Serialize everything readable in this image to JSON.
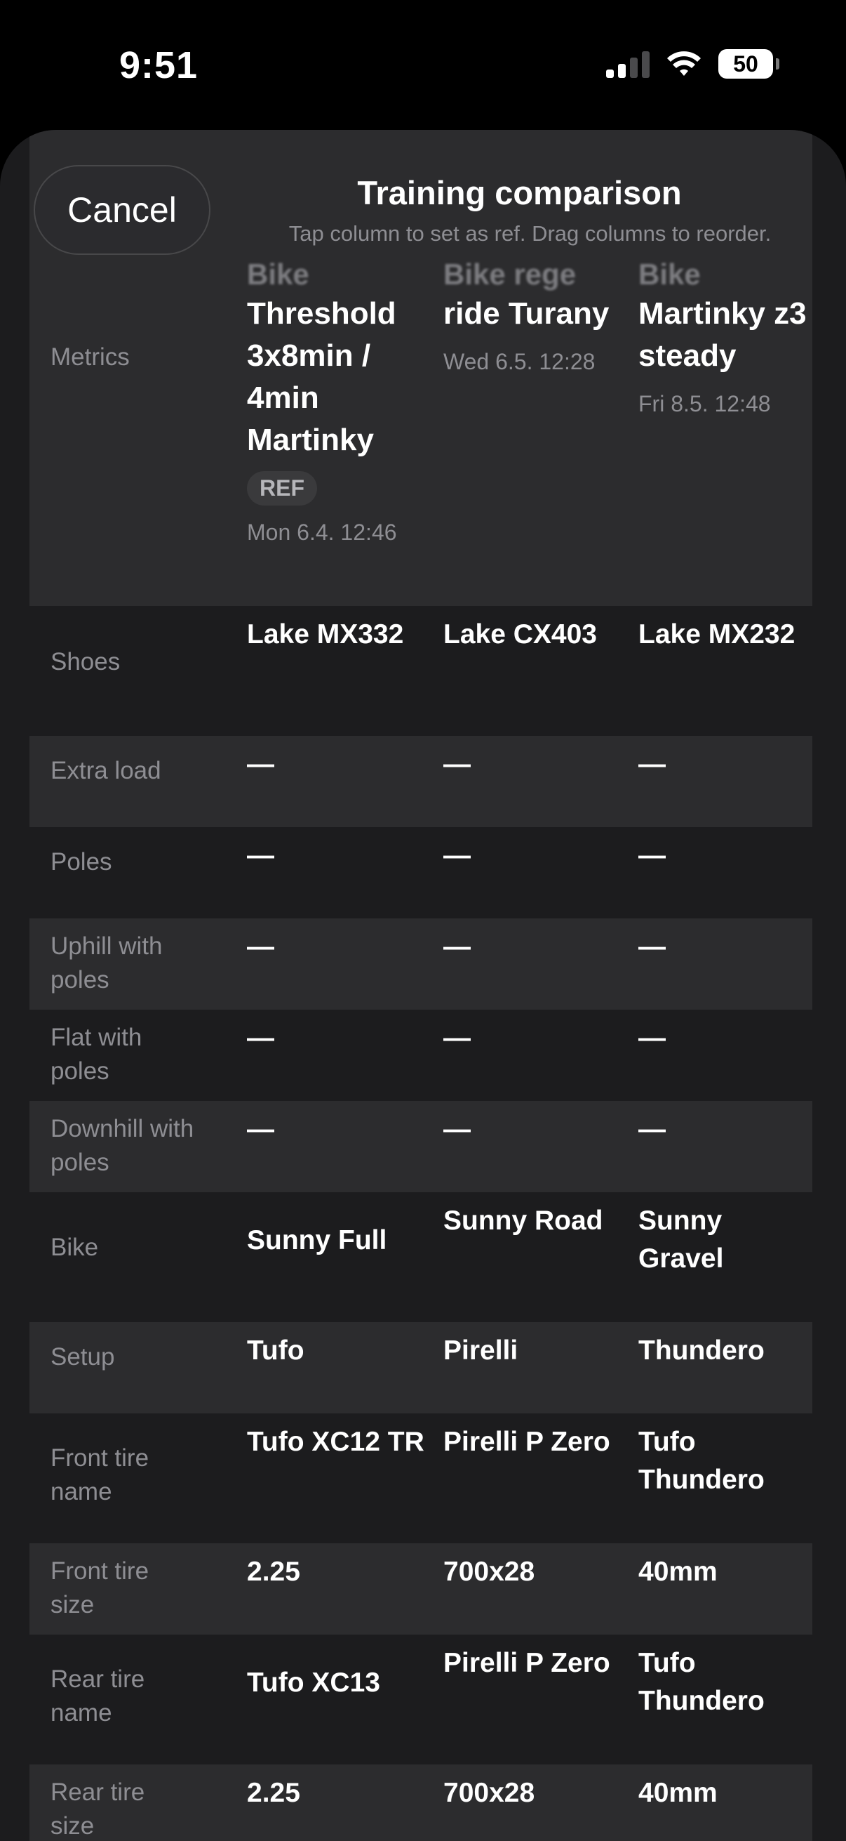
{
  "status": {
    "time": "9:51",
    "battery": "50"
  },
  "sheet": {
    "cancel": "Cancel",
    "title": "Training comparison",
    "subtitle": "Tap column to set as ref. Drag columns to reorder."
  },
  "header": {
    "label": "Metrics",
    "columns": [
      {
        "type": "Bike",
        "name": "Threshold 3x8min / 4min Martinky",
        "badge": "REF",
        "date": "Mon 6.4. 12:46"
      },
      {
        "type": "Bike rege",
        "name": "ride Turany",
        "date": "Wed 6.5. 12:28"
      },
      {
        "type": "Bike",
        "name": "Martinky z3 steady",
        "date": "Fri 8.5. 12:48"
      }
    ]
  },
  "rows": [
    {
      "label": "Shoes",
      "values": [
        "Lake MX332",
        "Lake CX403",
        "Lake MX232"
      ]
    },
    {
      "label": "Extra load",
      "values": [
        "—",
        "—",
        "—"
      ]
    },
    {
      "label": "Poles",
      "values": [
        "—",
        "—",
        "—"
      ]
    },
    {
      "label": "Uphill with poles",
      "values": [
        "—",
        "—",
        "—"
      ]
    },
    {
      "label": "Flat with poles",
      "values": [
        "—",
        "—",
        "—"
      ]
    },
    {
      "label": "Downhill with poles",
      "values": [
        "—",
        "—",
        "—"
      ]
    },
    {
      "label": "Bike",
      "values": [
        "Sunny Full",
        "Sunny Road",
        "Sunny Gravel"
      ]
    },
    {
      "label": "Setup",
      "values": [
        "Tufo",
        "Pirelli",
        "Thundero"
      ]
    },
    {
      "label": "Front tire name",
      "values": [
        "Tufo XC12 TR",
        "Pirelli P Zero",
        "Tufo Thundero"
      ]
    },
    {
      "label": "Front tire size",
      "values": [
        "2.25",
        "700x28",
        "40mm"
      ]
    },
    {
      "label": "Rear tire name",
      "values": [
        "Tufo XC13",
        "Pirelli P Zero",
        "Tufo Thundero"
      ]
    },
    {
      "label": "Rear tire size",
      "values": [
        "2.25",
        "700x28",
        "40mm"
      ]
    }
  ]
}
